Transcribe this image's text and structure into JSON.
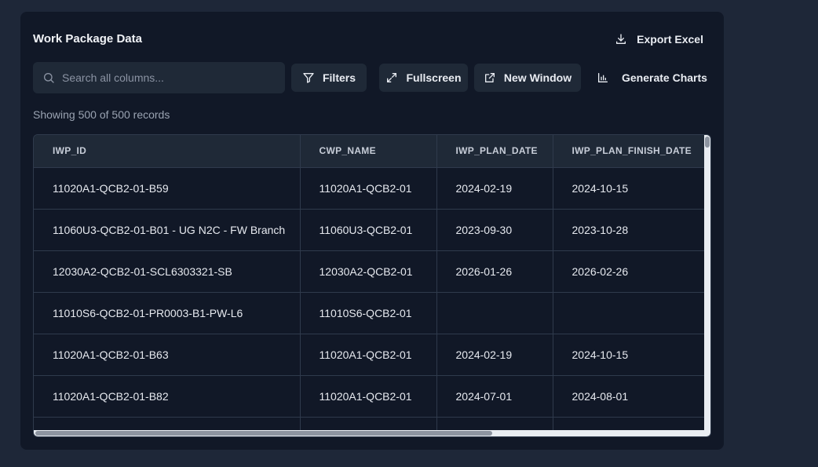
{
  "panel": {
    "title": "Work Package Data",
    "export_label": "Export Excel"
  },
  "toolbar": {
    "search_placeholder": "Search all columns...",
    "search_value": "",
    "filters_label": "Filters",
    "fullscreen_label": "Fullscreen",
    "new_window_label": "New Window",
    "charts_label": "Generate Charts"
  },
  "status": {
    "record_count": "Showing 500 of 500 records"
  },
  "table": {
    "columns": [
      "IWP_ID",
      "CWP_NAME",
      "IWP_PLAN_DATE",
      "IWP_PLAN_FINISH_DATE"
    ],
    "rows": [
      [
        "11020A1-QCB2-01-B59",
        "11020A1-QCB2-01",
        "2024-02-19",
        "2024-10-15"
      ],
      [
        "11060U3-QCB2-01-B01 - UG N2C - FW Branch",
        "11060U3-QCB2-01",
        "2023-09-30",
        "2023-10-28"
      ],
      [
        "12030A2-QCB2-01-SCL6303321-SB",
        "12030A2-QCB2-01",
        "2026-01-26",
        "2026-02-26"
      ],
      [
        "11010S6-QCB2-01-PR0003-B1-PW-L6",
        "11010S6-QCB2-01",
        "",
        ""
      ],
      [
        "11020A1-QCB2-01-B63",
        "11020A1-QCB2-01",
        "2024-02-19",
        "2024-10-15"
      ],
      [
        "11020A1-QCB2-01-B82",
        "11020A1-QCB2-01",
        "2024-07-01",
        "2024-08-01"
      ],
      [
        "",
        "",
        "",
        ""
      ]
    ]
  },
  "icons": {
    "export": "download-icon",
    "search": "search-icon",
    "filters": "filter-icon",
    "fullscreen": "expand-icon",
    "new_window": "external-link-icon",
    "charts": "bar-chart-icon"
  },
  "colors": {
    "page_bg": "#1e2738",
    "panel_bg": "#111827",
    "control_bg": "#1f2937",
    "text": "#e6e9ef",
    "muted_text": "#9aa3b2"
  }
}
